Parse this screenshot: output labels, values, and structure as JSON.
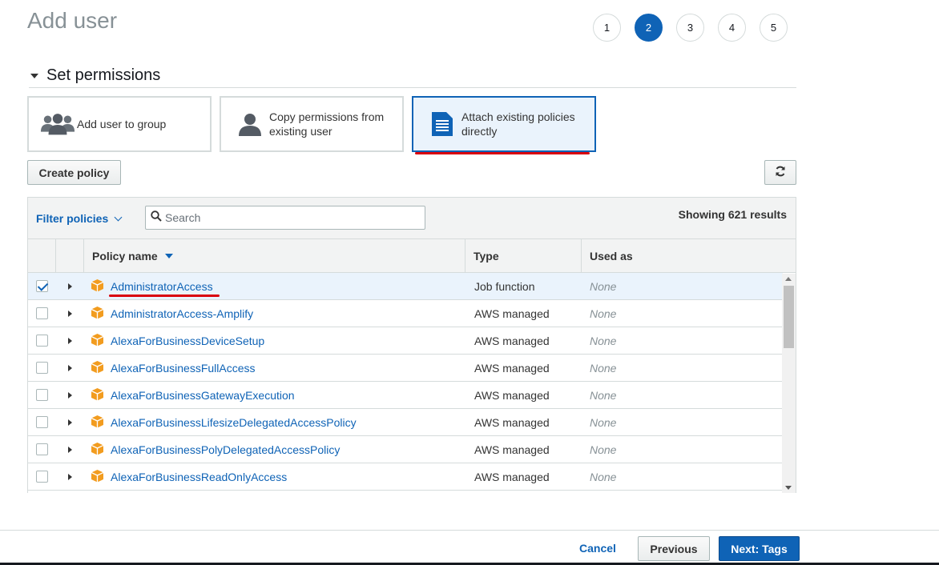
{
  "page": {
    "title": "Add user"
  },
  "steps": [
    "1",
    "2",
    "3",
    "4",
    "5"
  ],
  "active_step": "2",
  "section": {
    "title": "Set permissions"
  },
  "permission_options": [
    {
      "label": "Add user to group",
      "icon": "group-icon",
      "selected": false
    },
    {
      "label": "Copy permissions from existing user",
      "icon": "user-icon",
      "selected": false
    },
    {
      "label": "Attach existing policies directly",
      "icon": "document-icon",
      "selected": true
    }
  ],
  "toolbar": {
    "create_policy_label": "Create policy",
    "refresh_icon": "refresh-icon"
  },
  "filter": {
    "label": "Filter policies",
    "search_placeholder": "Search",
    "results_text": "Showing 621 results"
  },
  "table": {
    "columns": {
      "name": "Policy name",
      "type": "Type",
      "used_as": "Used as"
    },
    "rows": [
      {
        "name": "AdministratorAccess",
        "type": "Job function",
        "used_as": "None",
        "checked": true
      },
      {
        "name": "AdministratorAccess-Amplify",
        "type": "AWS managed",
        "used_as": "None",
        "checked": false
      },
      {
        "name": "AlexaForBusinessDeviceSetup",
        "type": "AWS managed",
        "used_as": "None",
        "checked": false
      },
      {
        "name": "AlexaForBusinessFullAccess",
        "type": "AWS managed",
        "used_as": "None",
        "checked": false
      },
      {
        "name": "AlexaForBusinessGatewayExecution",
        "type": "AWS managed",
        "used_as": "None",
        "checked": false
      },
      {
        "name": "AlexaForBusinessLifesizeDelegatedAccessPolicy",
        "type": "AWS managed",
        "used_as": "None",
        "checked": false
      },
      {
        "name": "AlexaForBusinessPolyDelegatedAccessPolicy",
        "type": "AWS managed",
        "used_as": "None",
        "checked": false
      },
      {
        "name": "AlexaForBusinessReadOnlyAccess",
        "type": "AWS managed",
        "used_as": "None",
        "checked": false
      }
    ]
  },
  "footer": {
    "cancel_label": "Cancel",
    "previous_label": "Previous",
    "next_label": "Next: Tags"
  },
  "colors": {
    "accent": "#0f63b6",
    "highlight": "#d9000d",
    "policy_icon": "#f29c1f"
  }
}
